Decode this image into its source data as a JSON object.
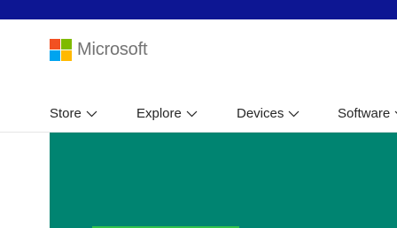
{
  "header": {
    "brand": {
      "name": "Microsoft",
      "logo_colors": [
        "#f25022",
        "#7fba00",
        "#00a4ef",
        "#ffb900"
      ]
    },
    "top_bar_color": "#0d1693"
  },
  "nav": {
    "items": [
      {
        "label": "Store",
        "icon": "chevron-down-icon"
      },
      {
        "label": "Explore",
        "icon": "chevron-down-icon"
      },
      {
        "label": "Devices",
        "icon": "chevron-down-icon"
      },
      {
        "label": "Software",
        "icon": "chevron-down-icon"
      }
    ]
  },
  "hero": {
    "background_color": "#008471",
    "accent_color": "#33c24b"
  }
}
